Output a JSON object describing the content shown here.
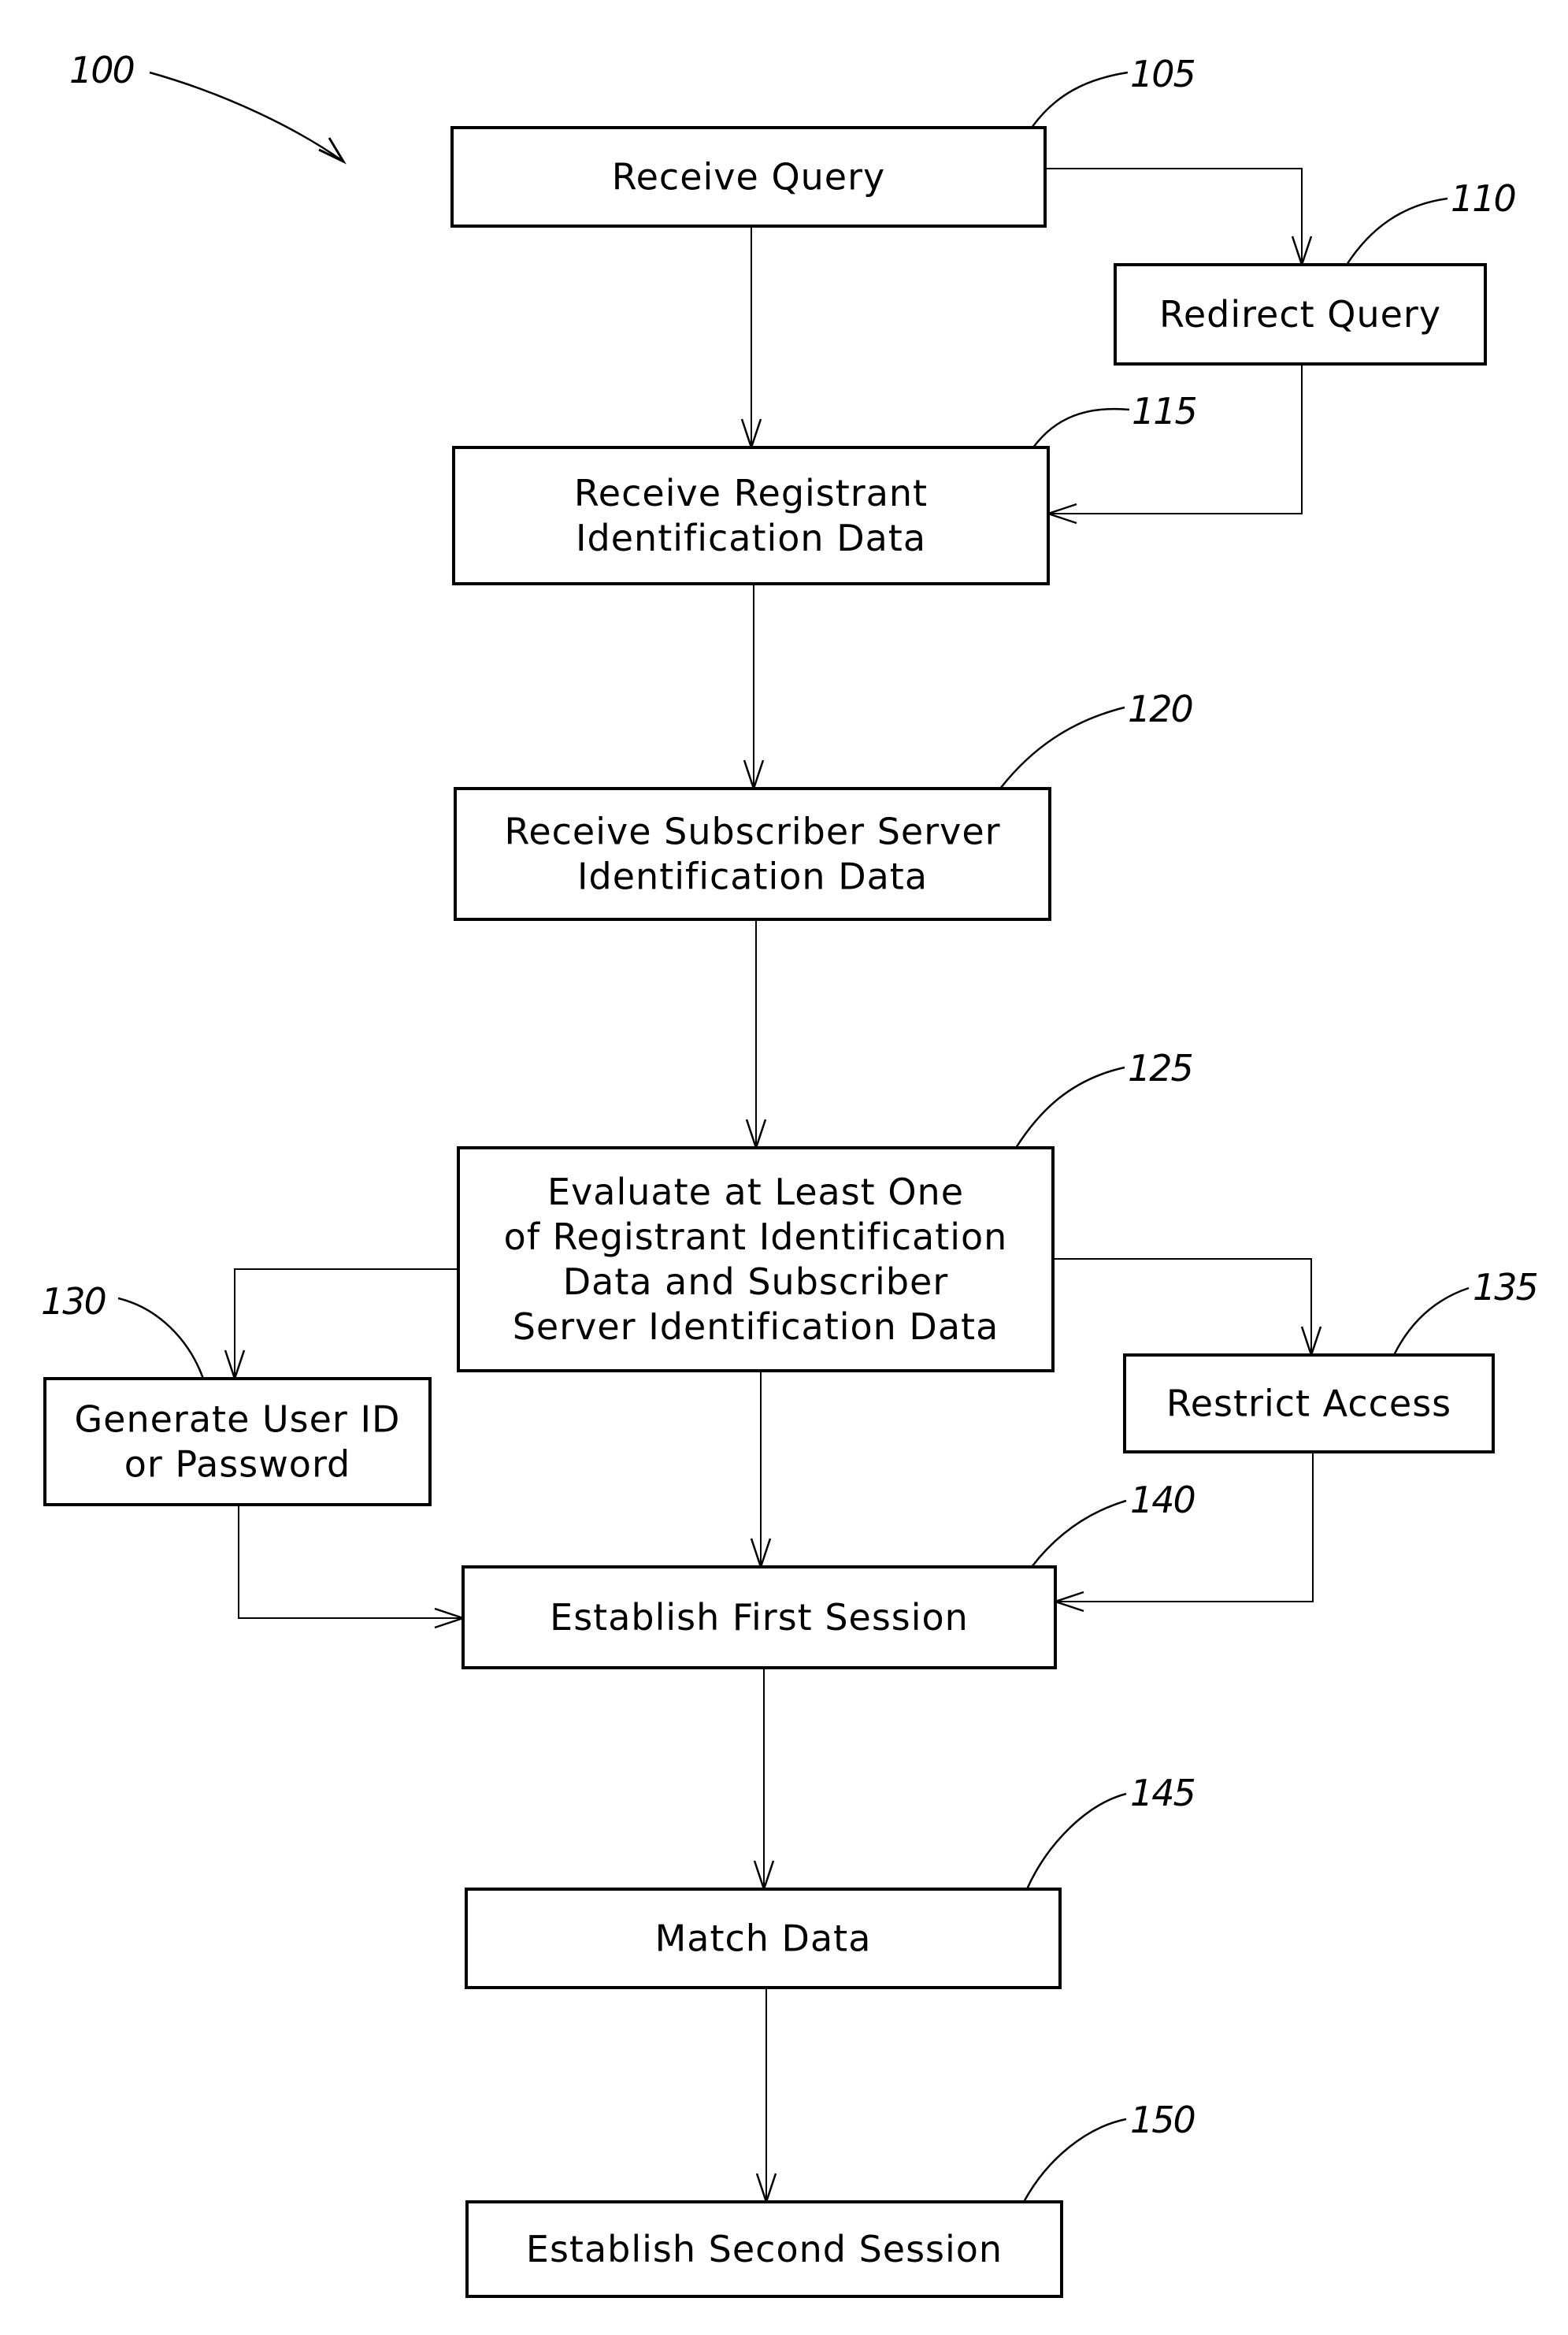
{
  "figure": {
    "reference": "100",
    "steps": [
      {
        "id": "105",
        "lines": [
          "Receive Query"
        ]
      },
      {
        "id": "110",
        "lines": [
          "Redirect Query"
        ]
      },
      {
        "id": "115",
        "lines": [
          "Receive Registrant",
          "Identification Data"
        ]
      },
      {
        "id": "120",
        "lines": [
          "Receive Subscriber Server",
          "Identification Data"
        ]
      },
      {
        "id": "125",
        "lines": [
          "Evaluate at Least One",
          "of Registrant Identification",
          "Data and Subscriber",
          "Server Identification Data"
        ]
      },
      {
        "id": "130",
        "lines": [
          "Generate User ID",
          "or Password"
        ]
      },
      {
        "id": "135",
        "lines": [
          "Restrict Access"
        ]
      },
      {
        "id": "140",
        "lines": [
          "Establish First Session"
        ]
      },
      {
        "id": "145",
        "lines": [
          "Match Data"
        ]
      },
      {
        "id": "150",
        "lines": [
          "Establish Second Session"
        ]
      }
    ],
    "connections": [
      {
        "from": "105",
        "to": "115"
      },
      {
        "from": "105",
        "to": "110"
      },
      {
        "from": "110",
        "to": "115"
      },
      {
        "from": "115",
        "to": "120"
      },
      {
        "from": "120",
        "to": "125"
      },
      {
        "from": "125",
        "to": "130"
      },
      {
        "from": "125",
        "to": "135"
      },
      {
        "from": "125",
        "to": "140"
      },
      {
        "from": "130",
        "to": "140"
      },
      {
        "from": "135",
        "to": "140"
      },
      {
        "from": "140",
        "to": "145"
      },
      {
        "from": "145",
        "to": "150"
      }
    ]
  }
}
